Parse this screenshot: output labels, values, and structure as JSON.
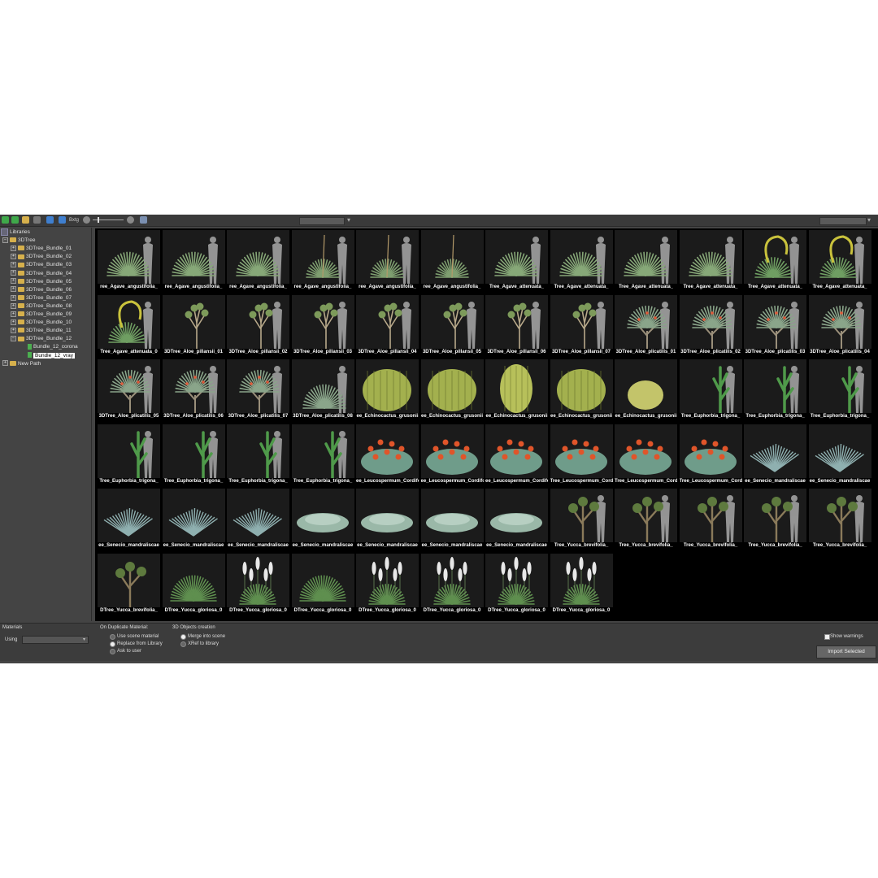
{
  "toolbar": {
    "zoom_text": "Bxtg"
  },
  "tree": {
    "root_label": "Libraries",
    "library": "3DTree",
    "bundles": [
      "3DTree_Bundle_01",
      "3DTree_Bundle_02",
      "3DTree_Bundle_03",
      "3DTree_Bundle_04",
      "3DTree_Bundle_05",
      "3DTree_Bundle_06",
      "3DTree_Bundle_07",
      "3DTree_Bundle_08",
      "3DTree_Bundle_09",
      "3DTree_Bundle_10",
      "3DTree_Bundle_11",
      "3DTree_Bundle_12"
    ],
    "leaves": [
      "Bundle_12_corona",
      "Bundle_12_vray"
    ],
    "new_path": "New Path"
  },
  "thumbnails": [
    {
      "label": "ree_Agave_angustifolia_",
      "type": "agave",
      "silhouette": true
    },
    {
      "label": "ree_Agave_angustifolia_",
      "type": "agave",
      "silhouette": true
    },
    {
      "label": "ree_Agave_angustifolia_",
      "type": "agave",
      "silhouette": true
    },
    {
      "label": "ree_Agave_angustifolia_",
      "type": "agave-flower",
      "silhouette": true
    },
    {
      "label": "ree_Agave_angustifolia_",
      "type": "agave-flower",
      "silhouette": true
    },
    {
      "label": "ree_Agave_angustifolia_",
      "type": "agave-flower",
      "silhouette": false
    },
    {
      "label": "Tree_Agave_attenuata_",
      "type": "agave",
      "silhouette": true
    },
    {
      "label": "Tree_Agave_attenuata_",
      "type": "agave",
      "silhouette": true
    },
    {
      "label": "Tree_Agave_attenuata_",
      "type": "agave",
      "silhouette": true
    },
    {
      "label": "Tree_Agave_attenuata_",
      "type": "agave",
      "silhouette": true
    },
    {
      "label": "Tree_Agave_attenuata_",
      "type": "agave-curl",
      "silhouette": true
    },
    {
      "label": "Tree_Agave_attenuata_",
      "type": "agave-curl",
      "silhouette": true
    },
    {
      "label": "Tree_Agave_attenuata_0",
      "type": "agave-curl",
      "silhouette": true
    },
    {
      "label": "3DTree_Aloe_pillansii_01",
      "type": "aloe",
      "silhouette": false
    },
    {
      "label": "3DTree_Aloe_pillansii_02",
      "type": "aloe",
      "silhouette": true
    },
    {
      "label": "3DTree_Aloe_pillansii_03",
      "type": "aloe",
      "silhouette": true
    },
    {
      "label": "3DTree_Aloe_pillansii_04",
      "type": "aloe",
      "silhouette": true
    },
    {
      "label": "3DTree_Aloe_pillansii_05",
      "type": "aloe",
      "silhouette": true
    },
    {
      "label": "3DTree_Aloe_pillansii_06",
      "type": "aloe",
      "silhouette": true
    },
    {
      "label": "3DTree_Aloe_pillansii_07",
      "type": "aloe",
      "silhouette": true
    },
    {
      "label": "3DTree_Aloe_plicatilis_01",
      "type": "plicatilis",
      "silhouette": true
    },
    {
      "label": "3DTree_Aloe_plicatilis_02",
      "type": "plicatilis",
      "silhouette": true
    },
    {
      "label": "3DTree_Aloe_plicatilis_03",
      "type": "plicatilis",
      "silhouette": true
    },
    {
      "label": "3DTree_Aloe_plicatilis_04",
      "type": "plicatilis",
      "silhouette": true
    },
    {
      "label": "3DTree_Aloe_plicatilis_05",
      "type": "plicatilis",
      "silhouette": true
    },
    {
      "label": "3DTree_Aloe_plicatilis_06",
      "type": "plicatilis",
      "silhouette": true
    },
    {
      "label": "3DTree_Aloe_plicatilis_07",
      "type": "plicatilis",
      "silhouette": true
    },
    {
      "label": "3DTree_Aloe_plicatilis_08",
      "type": "plicatilis-low",
      "silhouette": true
    },
    {
      "label": "ee_Echinocactus_grusonii",
      "type": "cactus-round",
      "silhouette": false
    },
    {
      "label": "ee_Echinocactus_grusonii",
      "type": "cactus-round",
      "silhouette": false
    },
    {
      "label": "ee_Echinocactus_grusonii",
      "type": "cactus-tall",
      "silhouette": false
    },
    {
      "label": "ee_Echinocactus_grusonii",
      "type": "cactus-round",
      "silhouette": false
    },
    {
      "label": "ee_Echinocactus_grusonii",
      "type": "cactus-small",
      "silhouette": false
    },
    {
      "label": "Tree_Euphorbia_trigona_",
      "type": "euphorbia",
      "silhouette": true
    },
    {
      "label": "Tree_Euphorbia_trigona_",
      "type": "euphorbia",
      "silhouette": true
    },
    {
      "label": "Tree_Euphorbia_trigona_",
      "type": "euphorbia",
      "silhouette": true
    },
    {
      "label": "Tree_Euphorbia_trigona_",
      "type": "euphorbia",
      "silhouette": true
    },
    {
      "label": "Tree_Euphorbia_trigona_",
      "type": "euphorbia",
      "silhouette": true
    },
    {
      "label": "Tree_Euphorbia_trigona_",
      "type": "euphorbia",
      "silhouette": true
    },
    {
      "label": "Tree_Euphorbia_trigona_",
      "type": "euphorbia",
      "silhouette": true
    },
    {
      "label": "ee_Leucospermum_Cordifolium",
      "type": "leucospermum",
      "silhouette": false
    },
    {
      "label": "ee_Leucospermum_Cordifolium",
      "type": "leucospermum",
      "silhouette": false
    },
    {
      "label": "ee_Leucospermum_Cordifolium",
      "type": "leucospermum",
      "silhouette": false
    },
    {
      "label": "Tree_Leucospermum_Cordifolium",
      "type": "leucospermum",
      "silhouette": false
    },
    {
      "label": "Tree_Leucospermum_Cordifolium",
      "type": "leucospermum",
      "silhouette": false
    },
    {
      "label": "Tree_Leucospermum_Cordifolium",
      "type": "leucospermum",
      "silhouette": false
    },
    {
      "label": "ee_Senecio_mandraliscae",
      "type": "senecio",
      "silhouette": false
    },
    {
      "label": "ee_Senecio_mandraliscae",
      "type": "senecio",
      "silhouette": false
    },
    {
      "label": "ee_Senecio_mandraliscae",
      "type": "senecio",
      "silhouette": false
    },
    {
      "label": "ee_Senecio_mandraliscae",
      "type": "senecio",
      "silhouette": false
    },
    {
      "label": "ee_Senecio_mandraliscae",
      "type": "senecio",
      "silhouette": false
    },
    {
      "label": "ee_Senecio_mandraliscae",
      "type": "senecio-flat",
      "silhouette": false
    },
    {
      "label": "ee_Senecio_mandraliscae",
      "type": "senecio-flat",
      "silhouette": false
    },
    {
      "label": "ee_Senecio_mandraliscae",
      "type": "senecio-flat",
      "silhouette": false
    },
    {
      "label": "ee_Senecio_mandraliscae",
      "type": "senecio-flat",
      "silhouette": false
    },
    {
      "label": "Tree_Yucca_brevifolia_",
      "type": "yucca-tree",
      "silhouette": true
    },
    {
      "label": "Tree_Yucca_brevifolia_",
      "type": "yucca-tree",
      "silhouette": true
    },
    {
      "label": "Tree_Yucca_brevifolia_",
      "type": "yucca-tree",
      "silhouette": true
    },
    {
      "label": "Tree_Yucca_brevifolia_",
      "type": "yucca-tree",
      "silhouette": true
    },
    {
      "label": "Tree_Yucca_brevifolia_",
      "type": "yucca-tree",
      "silhouette": true
    },
    {
      "label": "DTree_Yucca_brevifolia_",
      "type": "yucca-tree",
      "silhouette": false
    },
    {
      "label": "DTree_Yucca_gloriosa_0",
      "type": "yucca-gloriosa",
      "silhouette": false
    },
    {
      "label": "DTree_Yucca_gloriosa_0",
      "type": "yucca-bloom",
      "silhouette": false
    },
    {
      "label": "DTree_Yucca_gloriosa_0",
      "type": "yucca-gloriosa",
      "silhouette": false
    },
    {
      "label": "DTree_Yucca_gloriosa_0",
      "type": "yucca-bloom",
      "silhouette": false
    },
    {
      "label": "DTree_Yucca_gloriosa_0",
      "type": "yucca-bloom",
      "silhouette": false
    },
    {
      "label": "DTree_Yucca_gloriosa_0",
      "type": "yucca-bloom",
      "silhouette": false
    },
    {
      "label": "DTree_Yucca_gloriosa_0",
      "type": "yucca-bloom",
      "silhouette": false
    }
  ],
  "bottom": {
    "materials_label": "Materials",
    "using_label": "Using",
    "duplicate_title": "On Duplicate Material:",
    "duplicate_options": [
      "Use scene material",
      "Replace from Library",
      "Ask to user"
    ],
    "duplicate_selected": 1,
    "creation_title": "3D Objects creation",
    "creation_options": [
      "Merge into scene",
      "XRef to library"
    ],
    "creation_selected": 0,
    "show_warnings": "Show warnings",
    "import_button": "Import Selected"
  },
  "colors": {
    "folder": "#d6b04c",
    "leaf": "#4caf50",
    "plant_green": "#5f8f4f",
    "cactus": "#a3b04e",
    "flower": "#e0552a",
    "senecio": "#8fb0b0",
    "silhouette": "#a9a9a9"
  }
}
